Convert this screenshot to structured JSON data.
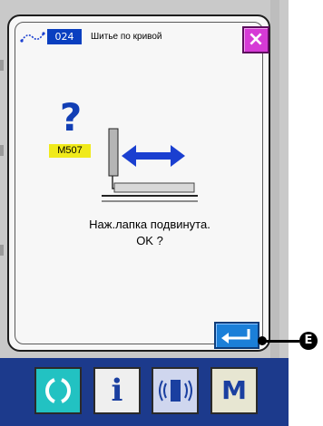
{
  "header": {
    "pattern_number": "024",
    "title": "Шитье по кривой",
    "close_label": "×"
  },
  "message": {
    "code": "M507",
    "help_glyph": "?",
    "line1": "Наж.лапка подвинута.",
    "line2": "OK ?"
  },
  "callout": {
    "label": "E"
  },
  "bottom_bar": {
    "info_glyph": "i",
    "mode_label": "M"
  },
  "colors": {
    "pattern_box": "#0a3fc0",
    "close_button": "#d63ad6",
    "enter_button": "#1b7fd8",
    "message_code": "#f0ea1a",
    "arrow": "#1a3fd0",
    "bottom_bar": "#1c3a8c"
  },
  "icons": {
    "curve": "curve-sewing-icon",
    "enter": "enter-arrow-icon",
    "reset": "reset-icon",
    "communication": "communication-icon"
  }
}
